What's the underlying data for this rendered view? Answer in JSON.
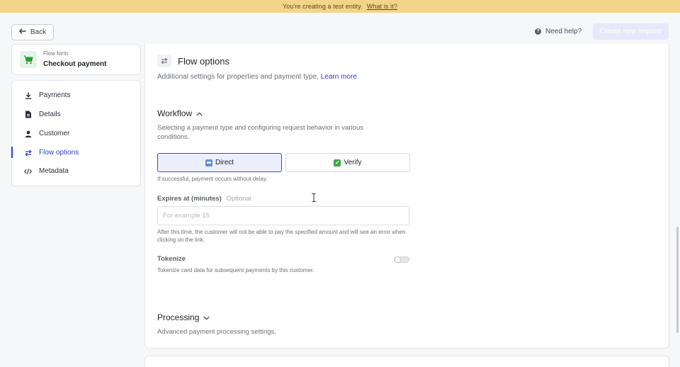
{
  "banner": {
    "text": "You're creating a test entity.",
    "link": "What is it?"
  },
  "topbar": {
    "back_label": "Back",
    "help_label": "Need help?",
    "create_label": "Create new request"
  },
  "flow_card": {
    "subtitle": "Flow form",
    "title": "Checkout payment",
    "icon": "cart-icon"
  },
  "sidebar": {
    "items": [
      {
        "label": "Payments",
        "icon": "download-icon"
      },
      {
        "label": "Details",
        "icon": "document-icon"
      },
      {
        "label": "Customer",
        "icon": "person-icon"
      },
      {
        "label": "Flow options",
        "icon": "swap-icon",
        "active": true
      },
      {
        "label": "Metadata",
        "icon": "code-icon"
      }
    ]
  },
  "main": {
    "title": "Flow options",
    "description": "Additional settings for properties and payment type.",
    "learn_more": "Learn more",
    "workflow": {
      "heading": "Workflow",
      "description": "Selecting a payment type and configuring request behavior in various conditions.",
      "options": [
        {
          "label": "Direct",
          "selected": true
        },
        {
          "label": "Verify",
          "selected": false
        }
      ],
      "option_hint": "If successful, payment occurs without delay.",
      "expires_label": "Expires at (minutes)",
      "expires_optional": "Optional",
      "expires_placeholder": "For example 15",
      "expires_hint": "After this time, the customer will not be able to pay the specified amount and will see an error when clicking on the link.",
      "tokenize_label": "Tokenize",
      "tokenize_hint": "Tokenize card data for subsequent payments by this customer.",
      "tokenize_on": false
    },
    "processing": {
      "heading": "Processing",
      "description": "Advanced payment processing settings."
    }
  },
  "colors": {
    "accent": "#2f3dd6",
    "banner": "#f3d58a",
    "success": "#3aa845"
  }
}
